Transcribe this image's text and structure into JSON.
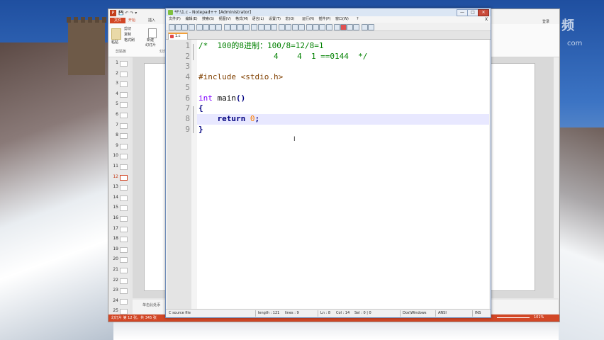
{
  "watermark": {
    "brand": "频",
    "sub": "com"
  },
  "powerpoint": {
    "logo": "P",
    "tabs": {
      "file": "文件",
      "home": "开始",
      "insert": "插入"
    },
    "ribbon": {
      "cut": "剪切",
      "copy": "复制",
      "format_painter": "格式刷",
      "paste": "粘贴",
      "new_slide": "新建",
      "slide_sub": "幻灯片",
      "clipboard": "剪贴板",
      "slides_group": "幻灯"
    },
    "right_tools": "登录",
    "slides": [
      {
        "num": "1"
      },
      {
        "num": "2"
      },
      {
        "num": "3"
      },
      {
        "num": "4"
      },
      {
        "num": "5"
      },
      {
        "num": "6"
      },
      {
        "num": "7"
      },
      {
        "num": "8"
      },
      {
        "num": "9"
      },
      {
        "num": "10"
      },
      {
        "num": "11"
      },
      {
        "num": "12"
      },
      {
        "num": "13"
      },
      {
        "num": "14"
      },
      {
        "num": "15"
      },
      {
        "num": "16"
      },
      {
        "num": "17"
      },
      {
        "num": "18"
      },
      {
        "num": "19"
      },
      {
        "num": "20"
      },
      {
        "num": "21"
      },
      {
        "num": "22"
      },
      {
        "num": "23"
      },
      {
        "num": "24"
      },
      {
        "num": "25"
      }
    ],
    "selected_slide": 12,
    "notes_placeholder": "单击此处添",
    "status_left": "幻灯片 第 12 张，共 345 张",
    "zoom": "101%"
  },
  "notepad": {
    "title": "*F:\\1.c - Notepad++ [Administrator]",
    "window_buttons": {
      "minimize": "—",
      "maximize": "□",
      "close": "✕"
    },
    "menu": [
      "文件(F)",
      "编辑(E)",
      "搜索(S)",
      "视图(V)",
      "格式(M)",
      "语言(L)",
      "设置(T)",
      "宏(O)",
      "运行(R)",
      "插件(P)",
      "窗口(W)",
      "?"
    ],
    "menu_close": "X",
    "tab_label": "1.c",
    "line_numbers": [
      "1",
      "2",
      "3",
      "4",
      "5",
      "6",
      "7",
      "8",
      "9"
    ],
    "code": {
      "l1_comment": "/*  100的8进制：100/8=12/8=1",
      "l2_comment": "                4    4  1 ==0144  */",
      "l4_include": "#include <stdio.h>",
      "l6_type": "int",
      "l6_name": " main",
      "l6_parens": "()",
      "l7_brace": "{",
      "l8_indent": "    ",
      "l8_return": "return",
      "l8_space": " ",
      "l8_zero": "0",
      "l8_semi": ";",
      "l9_brace": "}"
    },
    "status": {
      "lang": "C source file",
      "length": "length : 121",
      "lines": "lines : 9",
      "ln": "Ln : 8",
      "col": "Col : 14",
      "sel": "Sel : 0 | 0",
      "eol": "Dos\\Windows",
      "encoding": "ANSI",
      "mode": "INS"
    }
  }
}
